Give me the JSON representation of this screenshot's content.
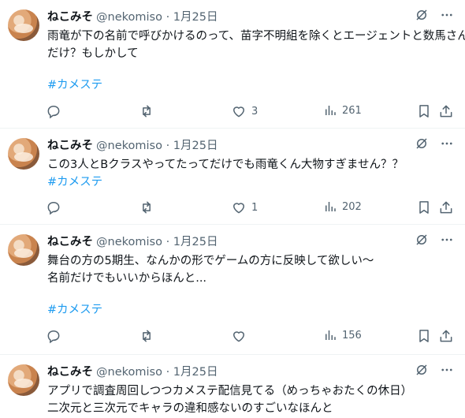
{
  "tweets": [
    {
      "name": "ねこみそ",
      "handle": "@nekomiso",
      "separator": "·",
      "date": "1月25日",
      "lines": [
        "雨竜が下の名前で呼びかけるのって、苗字不明組を除くとエージェントと数馬さん",
        "だけ？もしかして"
      ],
      "hashtag": "#カメステ",
      "likes": "3",
      "views": "261"
    },
    {
      "name": "ねこみそ",
      "handle": "@nekomiso",
      "separator": "·",
      "date": "1月25日",
      "lines": [
        "この3人とBクラスやってたってだけでも雨竜くん大物すぎません？？"
      ],
      "hashtag": "#カメステ",
      "likes": "1",
      "views": "202"
    },
    {
      "name": "ねこみそ",
      "handle": "@nekomiso",
      "separator": "·",
      "date": "1月25日",
      "lines": [
        "舞台の方の5期生、なんかの形でゲームの方に反映して欲しい〜",
        "名前だけでもいいからほんと..."
      ],
      "hashtag": "#カメステ",
      "likes": "",
      "views": "156"
    },
    {
      "name": "ねこみそ",
      "handle": "@nekomiso",
      "separator": "·",
      "date": "1月25日",
      "lines": [
        "アプリで調査周回しつつカメステ配信見てる（めっちゃおたくの休日）",
        "二次元と三次元でキャラの違和感ないのすごいなほんと"
      ],
      "hashtag": "",
      "likes": "",
      "views": ""
    }
  ],
  "icons": [
    "grok-icon",
    "more-icon",
    "reply-icon",
    "retweet-icon",
    "like-icon",
    "views-icon",
    "bookmark-icon",
    "share-icon"
  ],
  "colors": {
    "hashtag": "#1d9bf0",
    "secondary": "#536471",
    "divider": "#eff3f4"
  }
}
